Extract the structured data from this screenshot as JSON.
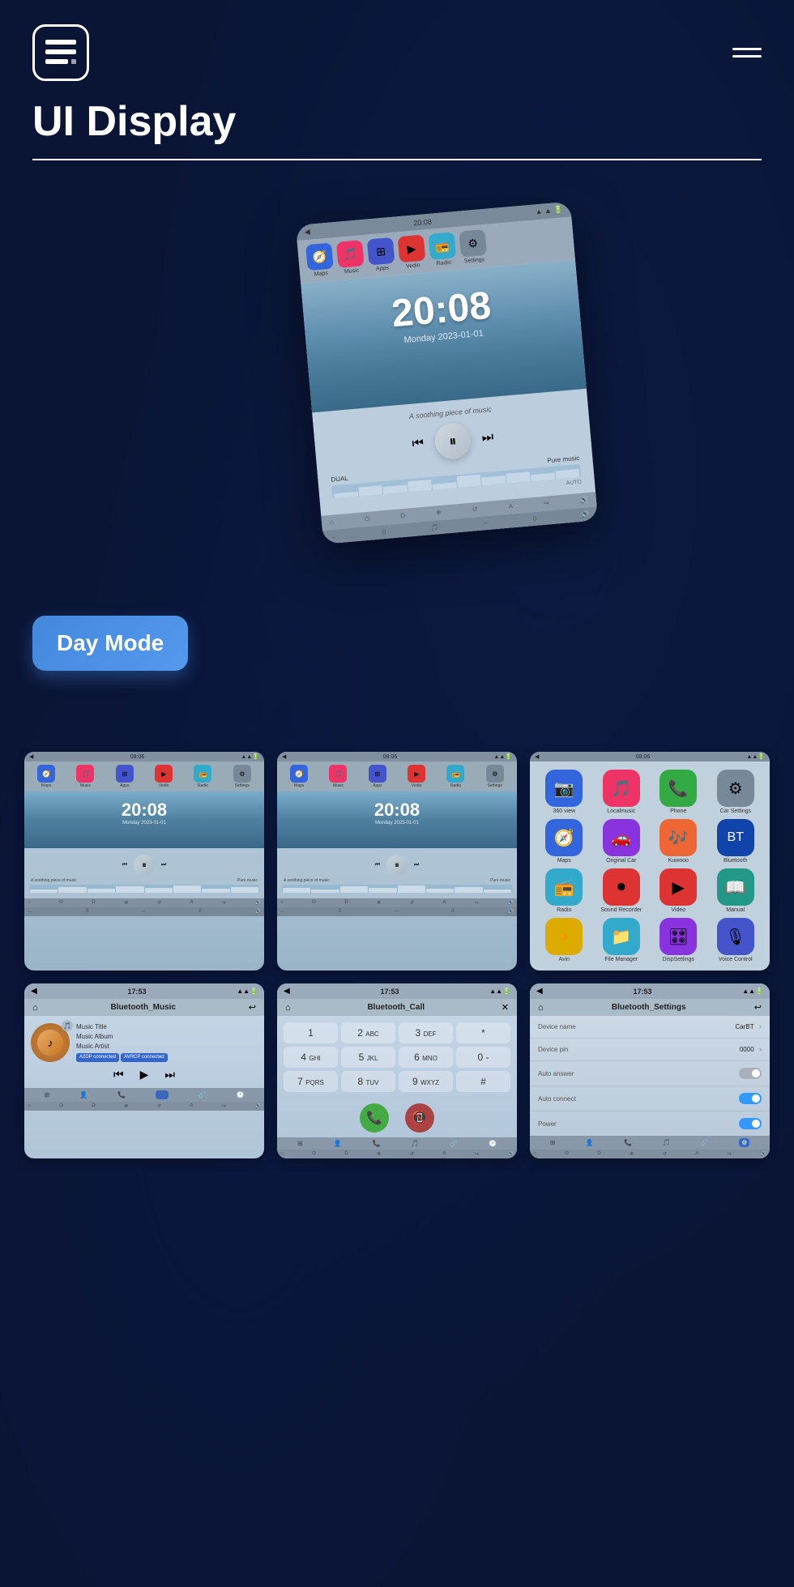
{
  "header": {
    "title": "UI Display",
    "logo_symbol": "≡",
    "menu_label": "menu"
  },
  "hero": {
    "clock_time": "20:08",
    "clock_date": "Monday  2023-01-01",
    "music_label": "A soothing piece of music",
    "music_label2": "Pure music",
    "nav_items": [
      {
        "label": "Maps",
        "color": "icon-blue",
        "icon": "🧭"
      },
      {
        "label": "Music",
        "color": "icon-pink",
        "icon": "🎵"
      },
      {
        "label": "Apps",
        "color": "icon-indigo",
        "icon": "⊞"
      },
      {
        "label": "Vedio",
        "color": "icon-red",
        "icon": "▶"
      },
      {
        "label": "Radio",
        "color": "icon-cyan",
        "icon": "📻"
      },
      {
        "label": "Settings",
        "color": "icon-gray",
        "icon": "⚙"
      }
    ]
  },
  "day_mode_label": "Day Mode",
  "grid_row1": {
    "card1": {
      "status_time": "08:06",
      "clock_time": "20:08",
      "clock_date": "Monday  2023-01-01",
      "music_label": "A soothing piece of music",
      "music_label2": "Pure music"
    },
    "card2": {
      "status_time": "08:06",
      "clock_time": "20:08",
      "clock_date": "Monday  2023-01-01",
      "music_label": "A soothing piece of music",
      "music_label2": "Pure music"
    },
    "card3": {
      "status_time": "08:06",
      "apps": [
        {
          "label": "360 view",
          "color": "icon-blue",
          "icon": "🔵"
        },
        {
          "label": "Localmusic",
          "color": "icon-pink",
          "icon": "🎵"
        },
        {
          "label": "Phone",
          "color": "icon-green",
          "icon": "📞"
        },
        {
          "label": "Car Settings",
          "color": "icon-gray",
          "icon": "⚙"
        },
        {
          "label": "Maps",
          "color": "icon-blue",
          "icon": "🧭"
        },
        {
          "label": "Original Car",
          "color": "icon-purple",
          "icon": "🚗"
        },
        {
          "label": "Kuwooo",
          "color": "icon-orange",
          "icon": "🎵"
        },
        {
          "label": "Bluetooth",
          "color": "icon-dark-blue",
          "icon": "🔷"
        },
        {
          "label": "Radio",
          "color": "icon-cyan",
          "icon": "📻"
        },
        {
          "label": "Sound Recorder",
          "color": "icon-red",
          "icon": "⏺"
        },
        {
          "label": "Video",
          "color": "icon-red",
          "icon": "▶"
        },
        {
          "label": "Manual",
          "color": "icon-teal",
          "icon": "📖"
        },
        {
          "label": "Avin",
          "color": "icon-yellow",
          "icon": "🔸"
        },
        {
          "label": "File Manager",
          "color": "icon-cyan",
          "icon": "📁"
        },
        {
          "label": "DispSettings",
          "color": "icon-purple",
          "icon": "🎛"
        },
        {
          "label": "Voice Control",
          "color": "icon-indigo",
          "icon": "🎙"
        }
      ]
    }
  },
  "grid_row2": {
    "card1": {
      "status_time": "17:53",
      "title": "Bluetooth_Music",
      "music_title": "Music Title",
      "music_album": "Music Album",
      "music_artist": "Music Artist",
      "badge1": "A2DP connected",
      "badge2": "AVRCP connected"
    },
    "card2": {
      "status_time": "17:53",
      "title": "Bluetooth_Call",
      "dial_keys": [
        "1",
        "2 ABC",
        "3 DEF",
        "*",
        "4 GHI",
        "5 JKL",
        "6 MNO",
        "0 -",
        "7 PQRS",
        "8 TUV",
        "9 WXYZ",
        "#"
      ]
    },
    "card3": {
      "status_time": "17:53",
      "title": "Bluetooth_Settings",
      "rows": [
        {
          "label": "Device name",
          "value": "CarBT",
          "type": "chevron"
        },
        {
          "label": "Device pin",
          "value": "0000",
          "type": "chevron"
        },
        {
          "label": "Auto answer",
          "value": "",
          "type": "toggle-off"
        },
        {
          "label": "Auto connect",
          "value": "",
          "type": "toggle-on"
        },
        {
          "label": "Power",
          "value": "",
          "type": "toggle-on"
        }
      ]
    }
  },
  "nav_icons": {
    "maps": "🧭",
    "music": "♪",
    "phone": "📞",
    "apps": "⊞",
    "settings": "⚙",
    "back": "←",
    "home": "⌂",
    "power": "⏻",
    "dual": "D",
    "snow": "❄",
    "auto": "A",
    "more": "≡"
  }
}
